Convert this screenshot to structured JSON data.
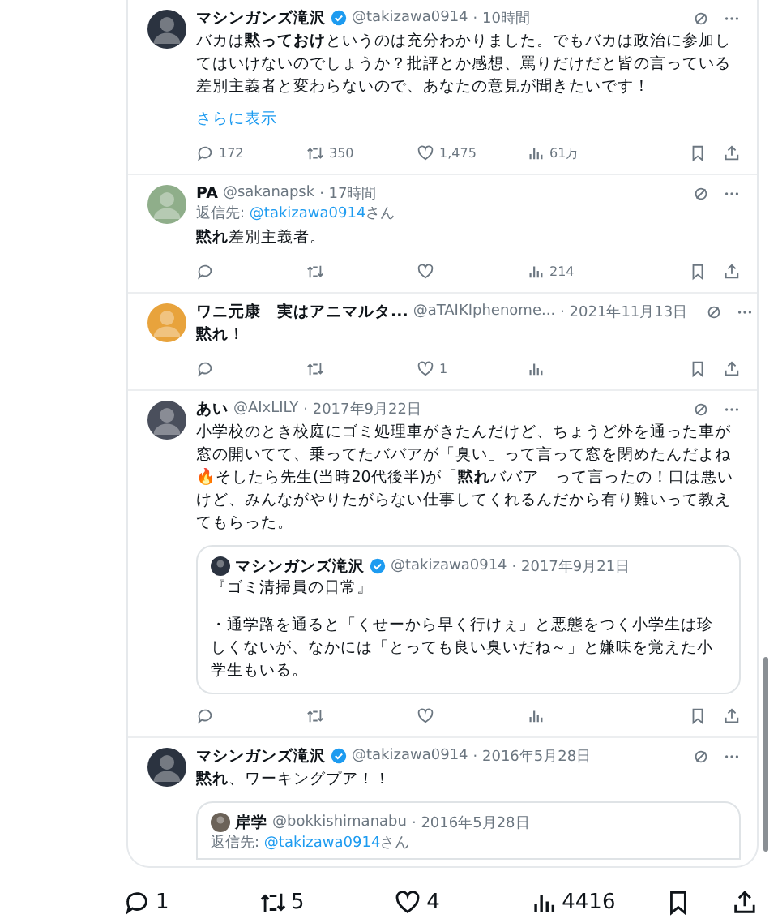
{
  "tweets": [
    {
      "color": "#2b3340",
      "name": "マシンガンズ滝沢",
      "verified": true,
      "handle": "@takizawa0914",
      "time": "· 10時間",
      "text": "バカは**黙っておけ**というのは充分わかりました。でもバカは政治に参加してはいけないのでしょうか？批評とか感想、罵りだけだと皆の言っている差別主義者と変わらないので、あなたの意見が聞きたいです！",
      "show_more": "さらに表示",
      "actions": {
        "reply": "172",
        "retweet": "350",
        "like": "1,475",
        "views": "61万"
      }
    },
    {
      "color": "#8fae8a",
      "name": "PA",
      "verified": false,
      "handle": "@sakanapsk",
      "time": "· 17時間",
      "reply_prefix": "返信先:",
      "reply_to": "@takizawa0914",
      "reply_suffix": "さん",
      "text": "**黙れ**差別主義者。",
      "actions": {
        "views": "214"
      }
    },
    {
      "color": "#e8a33c",
      "name": "ワニ元康　実はアニマルタ...",
      "verified": false,
      "handle": "@aTAIKIphenome...",
      "time": "· 2021年11月13日",
      "text": "**黙れ**！",
      "actions": {
        "like": "1"
      }
    },
    {
      "color": "#4a4f5c",
      "name": "あい",
      "verified": false,
      "handle": "@AIxLILY",
      "time": "· 2017年9月22日",
      "text": "小学校のとき校庭にゴミ処理車がきたんだけど、ちょうど外を通った車が窓の開いてて、乗ってたババアが「臭い」って言って窓を閉めたんだよね🔥そしたら先生(当時20代後半)が「**黙れ**ババア」って言ったの！口は悪いけど、みんながやりたがらない仕事してくれるんだから有り難いって教えてもらった。",
      "quote": {
        "color": "#2b3340",
        "name": "マシンガンズ滝沢",
        "verified": true,
        "handle": "@takizawa0914",
        "time": "· 2017年9月21日",
        "lines": [
          "『ゴミ清掃員の日常』",
          "・通学路を通ると「くせーから早く行けぇ」と悪態をつく小学生は珍しくないが、なかには「とっても良い臭いだね～」と嫌味を覚えた小学生もいる。"
        ]
      }
    },
    {
      "color": "#2b3340",
      "name": "マシンガンズ滝沢",
      "verified": true,
      "handle": "@takizawa0914",
      "time": "· 2016年5月28日",
      "text": "**黙れ**、ワーキングプア！！",
      "cut": true,
      "quote": {
        "color": "#6b6258",
        "name": "岸学",
        "verified": false,
        "handle": "@bokkishimanabu",
        "time": "· 2016年5月28日",
        "reply_prefix": "返信先:",
        "reply_to": "@takizawa0914",
        "reply_suffix": "さん"
      }
    }
  ],
  "bottom_bar": {
    "reply": "1",
    "retweet": "5",
    "like": "4",
    "views": "4416"
  }
}
